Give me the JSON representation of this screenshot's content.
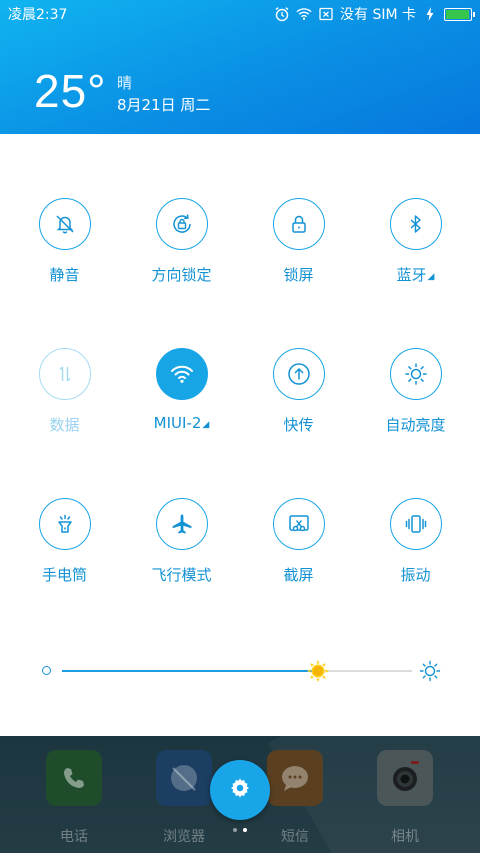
{
  "status_bar": {
    "time": "凌晨2:37",
    "sim_text": "没有 SIM 卡",
    "icons": [
      "alarm-icon",
      "wifi-icon",
      "no-sim-icon",
      "charging-icon",
      "battery-icon"
    ],
    "battery_level": 0.95
  },
  "weather": {
    "temperature": "25°",
    "condition": "晴",
    "date": "8月21日 周二"
  },
  "toggles": [
    {
      "label": "静音",
      "icon": "silent-bell-icon",
      "state": "off"
    },
    {
      "label": "方向锁定",
      "icon": "rotation-lock-icon",
      "state": "off"
    },
    {
      "label": "锁屏",
      "icon": "lock-icon",
      "state": "off"
    },
    {
      "label": "蓝牙",
      "icon": "bluetooth-icon",
      "state": "off",
      "has_submenu": true
    },
    {
      "label": "数据",
      "icon": "mobile-data-icon",
      "state": "disabled"
    },
    {
      "label": "MIUI-2",
      "icon": "wifi-icon",
      "state": "on",
      "has_submenu": true
    },
    {
      "label": "快传",
      "icon": "quick-transfer-icon",
      "state": "off"
    },
    {
      "label": "自动亮度",
      "icon": "auto-brightness-icon",
      "state": "off"
    },
    {
      "label": "手电筒",
      "icon": "flashlight-icon",
      "state": "off"
    },
    {
      "label": "飞行模式",
      "icon": "airplane-icon",
      "state": "off"
    },
    {
      "label": "截屏",
      "icon": "screenshot-icon",
      "state": "off"
    },
    {
      "label": "振动",
      "icon": "vibrate-icon",
      "state": "off"
    }
  ],
  "brightness": {
    "level": 0.73
  },
  "dock": {
    "apps": [
      {
        "label": "电话",
        "icon": "phone-icon",
        "color": "#2e7d32"
      },
      {
        "label": "浏览器",
        "icon": "browser-icon",
        "color": "#1f5fa8"
      },
      {
        "label": "短信",
        "icon": "message-icon",
        "color": "#e07a18"
      },
      {
        "label": "相机",
        "icon": "camera-icon",
        "color": "#d9d9d9"
      }
    ],
    "pages": 2,
    "current_page": 2
  },
  "colors": {
    "accent": "#18a5e6",
    "header_start": "#10b4f0",
    "header_end": "#0777de"
  }
}
